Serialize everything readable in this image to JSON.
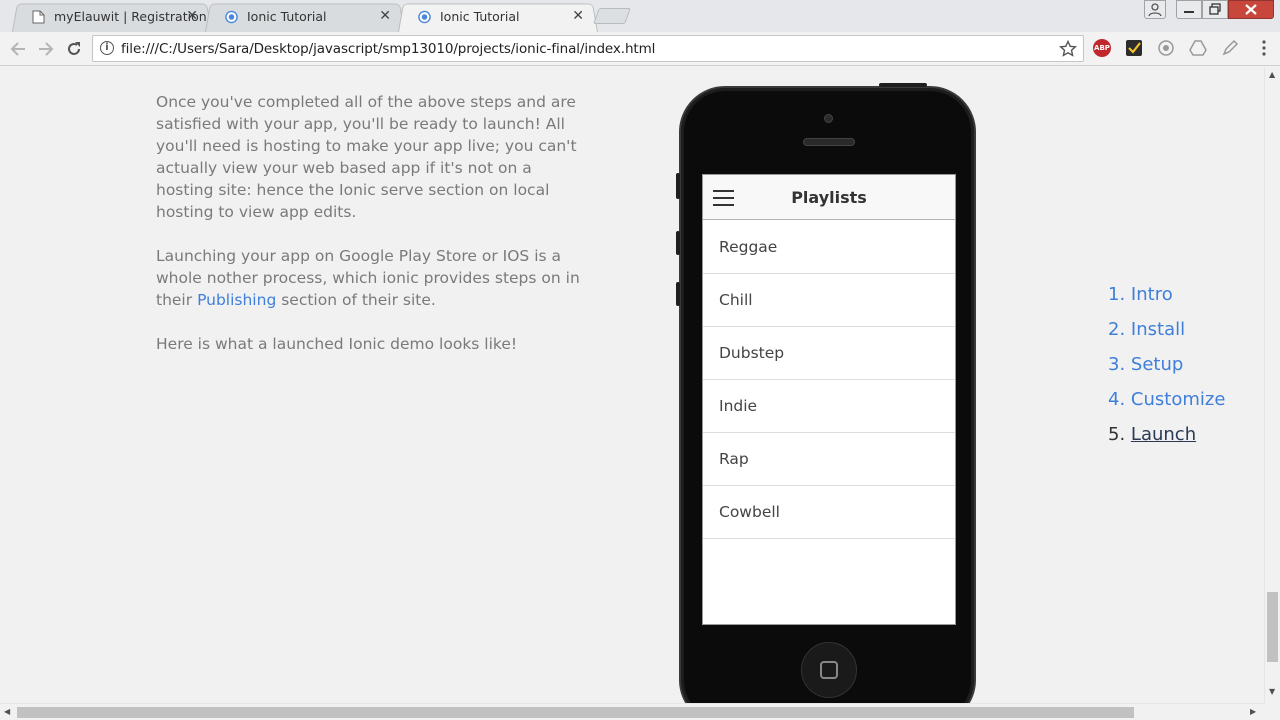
{
  "browser": {
    "tabs": [
      {
        "title": "myElauwit | Registration",
        "icon": "page-icon",
        "active": false
      },
      {
        "title": "Ionic Tutorial",
        "icon": "chrome-favicon-icon",
        "active": false
      },
      {
        "title": "Ionic Tutorial",
        "icon": "chrome-favicon-icon",
        "active": true
      }
    ],
    "tab_close_glyph": "✕",
    "url": "file:///C:/Users/Sara/Desktop/javascript/smp13010/projects/ionic-final/index.html",
    "extensions": {
      "abp_label": "ABP"
    }
  },
  "article": {
    "para1": "Once you've completed all of the above steps and are satisfied with your app, you'll be ready to launch! All you'll need is hosting to make your app live; you can't actually view your web based app if it's not on a hosting site: hence the Ionic serve section on local hosting to view app edits.",
    "para2_before": "Launching your app on Google Play Store or IOS is a whole nother process, which ionic provides steps on in their",
    "para2_link": "Publishing",
    "para2_after": "section of their site.",
    "para3": "Here is what a launched Ionic demo looks like!"
  },
  "demo_app": {
    "title": "Playlists",
    "playlists": [
      "Reggae",
      "Chill",
      "Dubstep",
      "Indie",
      "Rap",
      "Cowbell"
    ]
  },
  "toc": {
    "items": [
      {
        "num": "1.",
        "label": "Intro"
      },
      {
        "num": "2.",
        "label": "Install"
      },
      {
        "num": "3.",
        "label": "Setup"
      },
      {
        "num": "4.",
        "label": "Customize"
      },
      {
        "num": "5.",
        "label": "Launch"
      }
    ],
    "current_index": 4
  },
  "colors": {
    "link": "#3f7fd9",
    "body_text": "#7a7a7a",
    "page_bg": "#f1f1f1"
  }
}
